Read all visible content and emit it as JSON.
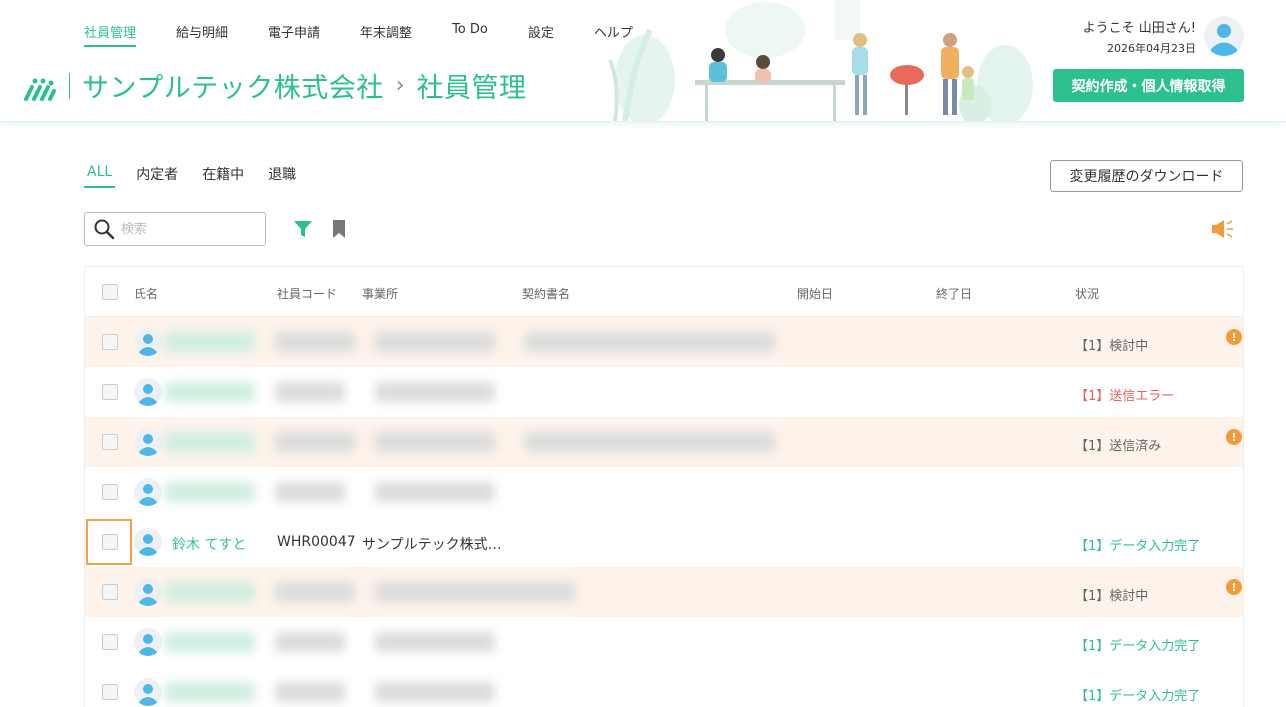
{
  "nav": {
    "items": [
      {
        "label": "社員管理",
        "active": true
      },
      {
        "label": "給与明細",
        "active": false
      },
      {
        "label": "電子申請",
        "active": false
      },
      {
        "label": "年末調整",
        "active": false
      },
      {
        "label": "To Do",
        "active": false
      },
      {
        "label": "設定",
        "active": false
      },
      {
        "label": "ヘルプ",
        "active": false
      }
    ]
  },
  "brand": {
    "company": "サンプルテック株式会社",
    "separator": "›",
    "page": "社員管理"
  },
  "user": {
    "welcome": "ようこそ 山田さん!",
    "date": "2026年04月23日"
  },
  "cta_label": "契約作成・個人情報取得",
  "tabs": [
    {
      "label": "ALL",
      "active": true
    },
    {
      "label": "内定者",
      "active": false
    },
    {
      "label": "在籍中",
      "active": false
    },
    {
      "label": "退職",
      "active": false
    }
  ],
  "download_label": "変更履歴のダウンロード",
  "search": {
    "placeholder": "検索"
  },
  "icons": {
    "search": "search-icon",
    "filter": "filter-icon",
    "bookmark": "bookmark-icon",
    "announce": "megaphone-icon",
    "avatar": "user-avatar-icon",
    "alert": "exclamation-icon"
  },
  "colors": {
    "accent": "#2cc08e",
    "pending_row": "#fdf3ea",
    "error": "#e8605a",
    "alert": "#f39a3b",
    "focus": "#f2a34a"
  },
  "table": {
    "headers": {
      "name": "氏名",
      "code": "社員コード",
      "office": "事業所",
      "contract": "契約書名",
      "start": "開始日",
      "end": "終了日",
      "status": "状況"
    },
    "rows": [
      {
        "name": "",
        "code": "",
        "office": "",
        "status": "【1】検討中",
        "status_type": "review",
        "alert": true,
        "pending": true,
        "blurred": true
      },
      {
        "name": "",
        "code": "",
        "office": "",
        "status": "【1】送信エラー",
        "status_type": "error",
        "alert": false,
        "pending": false,
        "blurred": true
      },
      {
        "name": "",
        "code": "",
        "office": "",
        "status": "【1】送信済み",
        "status_type": "sent",
        "alert": true,
        "pending": true,
        "blurred": true
      },
      {
        "name": "",
        "code": "",
        "office": "",
        "status": "",
        "status_type": "none",
        "alert": false,
        "pending": false,
        "blurred": true
      },
      {
        "name": "鈴木 てすと",
        "code": "WHR00047",
        "office": "サンプルテック株式会社",
        "status": "【1】データ入力完了",
        "status_type": "done",
        "alert": false,
        "pending": false,
        "blurred": false,
        "focused": true
      },
      {
        "name": "",
        "code": "",
        "office": "",
        "status": "【1】検討中",
        "status_type": "review",
        "alert": true,
        "pending": true,
        "blurred": true
      },
      {
        "name": "",
        "code": "",
        "office": "",
        "status": "【1】データ入力完了",
        "status_type": "done",
        "alert": false,
        "pending": false,
        "blurred": true
      },
      {
        "name": "",
        "code": "",
        "office": "",
        "status": "【1】データ入力完了",
        "status_type": "done",
        "alert": false,
        "pending": false,
        "blurred": true
      }
    ]
  }
}
